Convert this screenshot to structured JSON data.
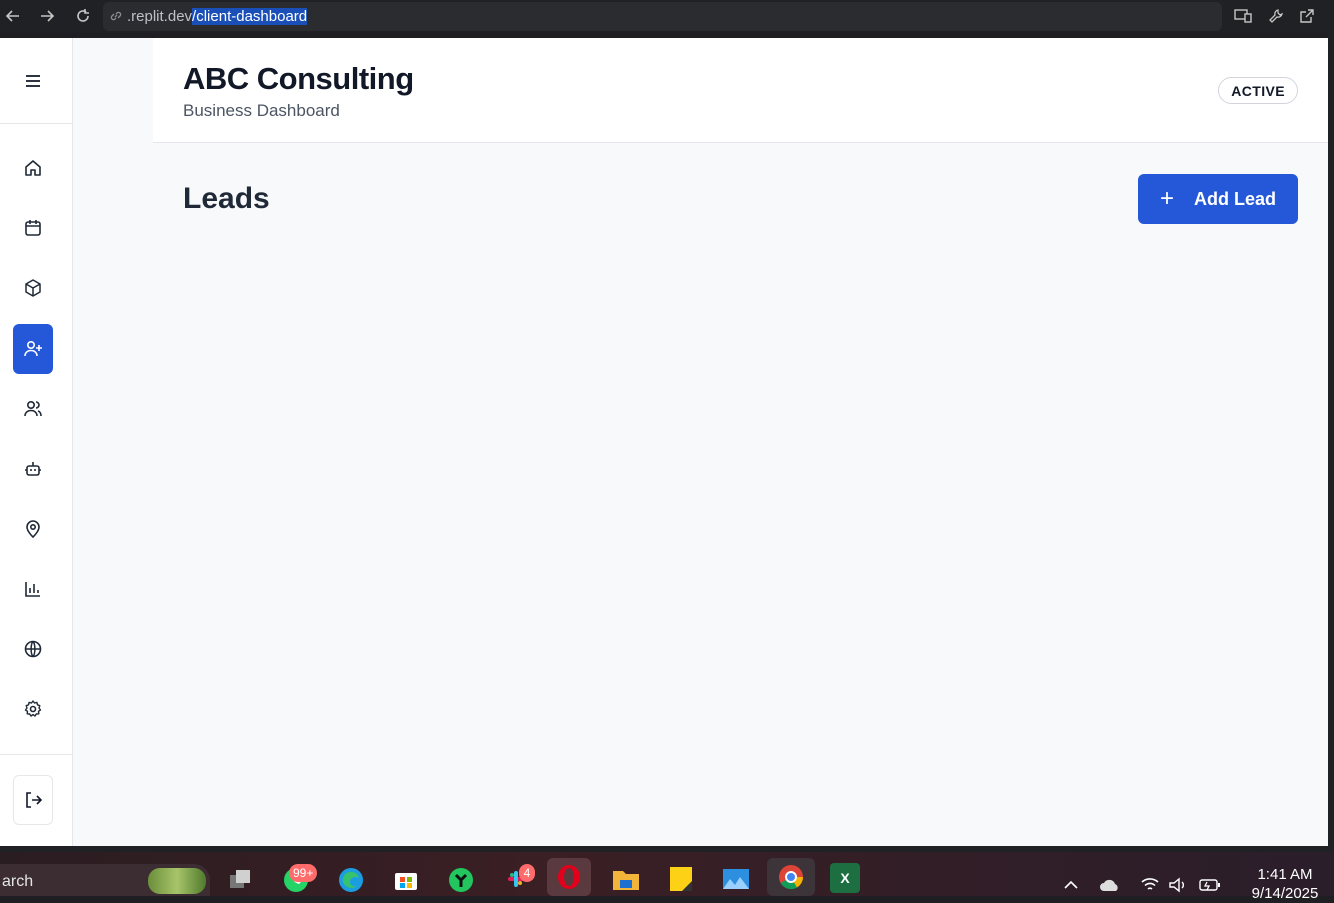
{
  "browser": {
    "url_prefix": ".replit.dev",
    "url_path": "/client-dashboard"
  },
  "header": {
    "company": "ABC Consulting",
    "subtitle": "Business Dashboard",
    "status": "ACTIVE"
  },
  "page": {
    "title": "Leads",
    "add_button": "Add Lead",
    "add_plus": "+"
  },
  "sidebar": {
    "active_item": "leads",
    "items": [
      "home",
      "calendar",
      "package",
      "leads",
      "users",
      "bot",
      "location",
      "analytics",
      "globe",
      "settings"
    ]
  },
  "taskbar": {
    "search_text": "arch",
    "whatsapp_badge": "99+",
    "slack_badge": "4",
    "excel_letter": "X",
    "time": "1:41 AM",
    "date": "9/14/2025"
  },
  "colors": {
    "accent": "#2458d8"
  }
}
